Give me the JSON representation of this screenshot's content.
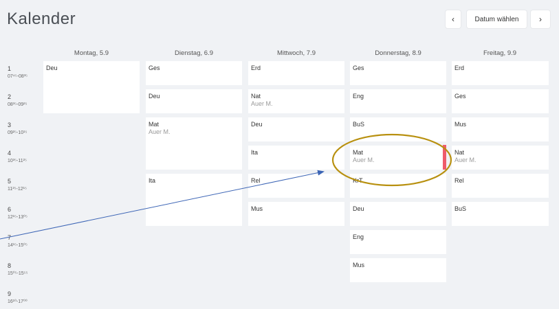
{
  "page_title": "Kalender",
  "nav": {
    "prev_glyph": "‹",
    "date_button": "Datum wählen",
    "next_glyph": "›"
  },
  "days": [
    {
      "label": "Montag, 5.9"
    },
    {
      "label": "Dienstag, 6.9"
    },
    {
      "label": "Mittwoch, 7.9"
    },
    {
      "label": "Donnerstag, 8.9"
    },
    {
      "label": "Freitag, 9.9"
    }
  ],
  "periods": [
    {
      "num": "1",
      "time": "07⁴⁵-08³⁵"
    },
    {
      "num": "2",
      "time": "08³⁵-09²⁵"
    },
    {
      "num": "3",
      "time": "09²⁵-10¹⁵"
    },
    {
      "num": "4",
      "time": "10³⁵-11²⁵"
    },
    {
      "num": "5",
      "time": "11²⁵-12¹⁵"
    },
    {
      "num": "6",
      "time": "12¹⁵-13⁰⁵"
    },
    {
      "num": "7",
      "time": "14¹⁵-15⁰⁵"
    },
    {
      "num": "8",
      "time": "15⁰⁵-15⁵⁵"
    },
    {
      "num": "9",
      "time": "16¹⁰-17⁰⁰"
    }
  ],
  "lessons": {
    "mon": [
      {
        "subject": "Deu",
        "teacher": ""
      }
    ],
    "tue": [
      {
        "subject": "Ges",
        "teacher": ""
      },
      {
        "subject": "Deu",
        "teacher": ""
      },
      {
        "subject": "Mat",
        "teacher": "Auer M."
      },
      {
        "subject": "Ita",
        "teacher": ""
      }
    ],
    "wed": [
      {
        "subject": "Erd",
        "teacher": ""
      },
      {
        "subject": "Nat",
        "teacher": "Auer M."
      },
      {
        "subject": "Deu",
        "teacher": ""
      },
      {
        "subject": "Ita",
        "teacher": ""
      },
      {
        "subject": "Rel",
        "teacher": ""
      },
      {
        "subject": "Mus",
        "teacher": ""
      }
    ],
    "thu": [
      {
        "subject": "Ges",
        "teacher": ""
      },
      {
        "subject": "Eng",
        "teacher": ""
      },
      {
        "subject": "BuS",
        "teacher": ""
      },
      {
        "subject": "Mat",
        "teacher": "Auer M."
      },
      {
        "subject": "KrT",
        "teacher": ""
      },
      {
        "subject": "Deu",
        "teacher": ""
      },
      {
        "subject": "Eng",
        "teacher": ""
      },
      {
        "subject": "Mus",
        "teacher": ""
      }
    ],
    "fri": [
      {
        "subject": "Erd",
        "teacher": ""
      },
      {
        "subject": "Ges",
        "teacher": ""
      },
      {
        "subject": "Mus",
        "teacher": ""
      },
      {
        "subject": "Nat",
        "teacher": "Auer M."
      },
      {
        "subject": "Rel",
        "teacher": ""
      },
      {
        "subject": "BuS",
        "teacher": ""
      }
    ]
  },
  "colors": {
    "background": "#f0f2f5",
    "marker": "#ef5b6b",
    "highlight_ellipse": "#b8900f",
    "arrow": "#3b64b5"
  }
}
